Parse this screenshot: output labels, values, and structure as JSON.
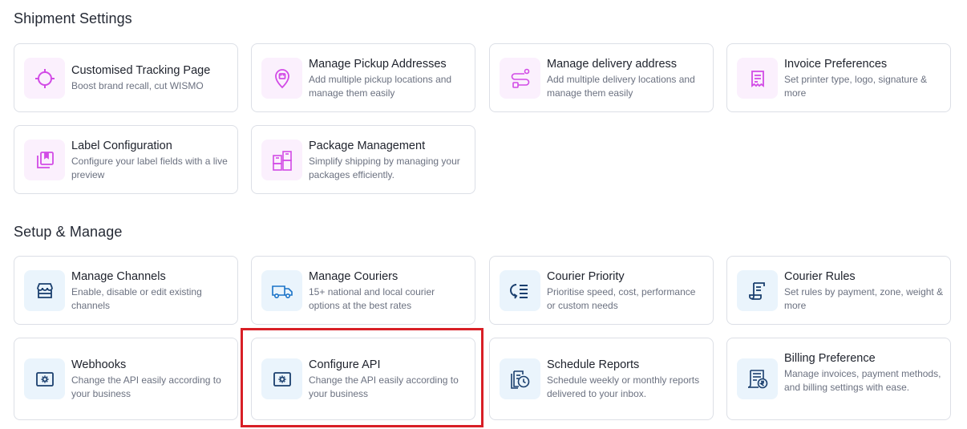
{
  "shipment": {
    "title": "Shipment Settings",
    "cards": [
      {
        "title": "Customised Tracking Page",
        "desc": "Boost brand recall, cut WISMO",
        "icon": "crosshair-icon"
      },
      {
        "title": "Manage Pickup Addresses",
        "desc": "Add multiple pickup locations and manage them easily",
        "icon": "pickup-pin-icon"
      },
      {
        "title": "Manage delivery address",
        "desc": "Add multiple delivery locations and manage them easily",
        "icon": "delivery-route-icon"
      },
      {
        "title": "Invoice Preferences",
        "desc": "Set printer type, logo, signature & more",
        "icon": "invoice-icon"
      },
      {
        "title": "Label Configuration",
        "desc": "Configure your label fields with a live preview",
        "icon": "label-icon"
      },
      {
        "title": "Package Management",
        "desc": "Simplify shipping by managing your packages efficiently.",
        "icon": "packages-icon"
      }
    ]
  },
  "setup": {
    "title": "Setup & Manage",
    "cards": [
      {
        "title": "Manage Channels",
        "desc": "Enable, disable or edit existing channels",
        "icon": "store-icon"
      },
      {
        "title": "Manage Couriers",
        "desc": "15+ national and local courier options at the best rates",
        "icon": "truck-icon"
      },
      {
        "title": "Courier Priority",
        "desc": "Prioritise speed, cost, performance or custom needs",
        "icon": "priority-list-icon"
      },
      {
        "title": "Courier Rules",
        "desc": "Set rules by payment, zone, weight & more",
        "icon": "rules-scroll-icon"
      },
      {
        "title": "Webhooks",
        "desc": "Change the API easily according to your business",
        "icon": "api-gear-icon"
      },
      {
        "title": "Configure API",
        "desc": "Change the API easily according to your business",
        "icon": "api-gear-icon"
      },
      {
        "title": "Schedule Reports",
        "desc": "Schedule weekly or monthly reports delivered to your inbox.",
        "icon": "report-clock-icon"
      },
      {
        "title": "Billing Preference",
        "desc": "Manage invoices, payment methods, and billing settings with ease.",
        "icon": "billing-icon"
      }
    ]
  },
  "colors": {
    "pink_icon": "#d24be6",
    "blue_icon": "#1a73c8",
    "highlight": "#d81f26"
  }
}
